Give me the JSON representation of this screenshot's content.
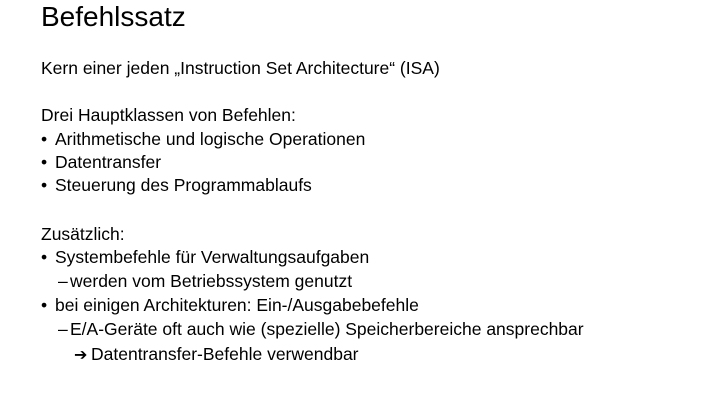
{
  "slide": {
    "title": "Befehlssatz",
    "intro": "Kern einer jeden „Instruction Set Architecture“ (ISA)",
    "classes_heading": "Drei Hauptklassen von Befehlen:",
    "classes": [
      "Arithmetische und logische Operationen",
      "Datentransfer",
      "Steuerung des Programmablaufs"
    ],
    "additional_heading": "Zusätzlich:",
    "additional": [
      {
        "text": "Systembefehle für Verwaltungsaufgaben",
        "sub": "werden vom Betriebssystem genutzt"
      },
      {
        "text": "bei einigen Architekturen: Ein-/Ausgabebefehle",
        "sub": "E/A-Geräte oft auch wie (spezielle) Speicherbereiche ansprechbar",
        "consequence": "Datentransfer-Befehle verwendbar"
      }
    ],
    "bullet_glyph": "•",
    "dash_glyph": "–",
    "arrow_icon": "arrow-right-icon",
    "arrow_glyph": "➔"
  }
}
